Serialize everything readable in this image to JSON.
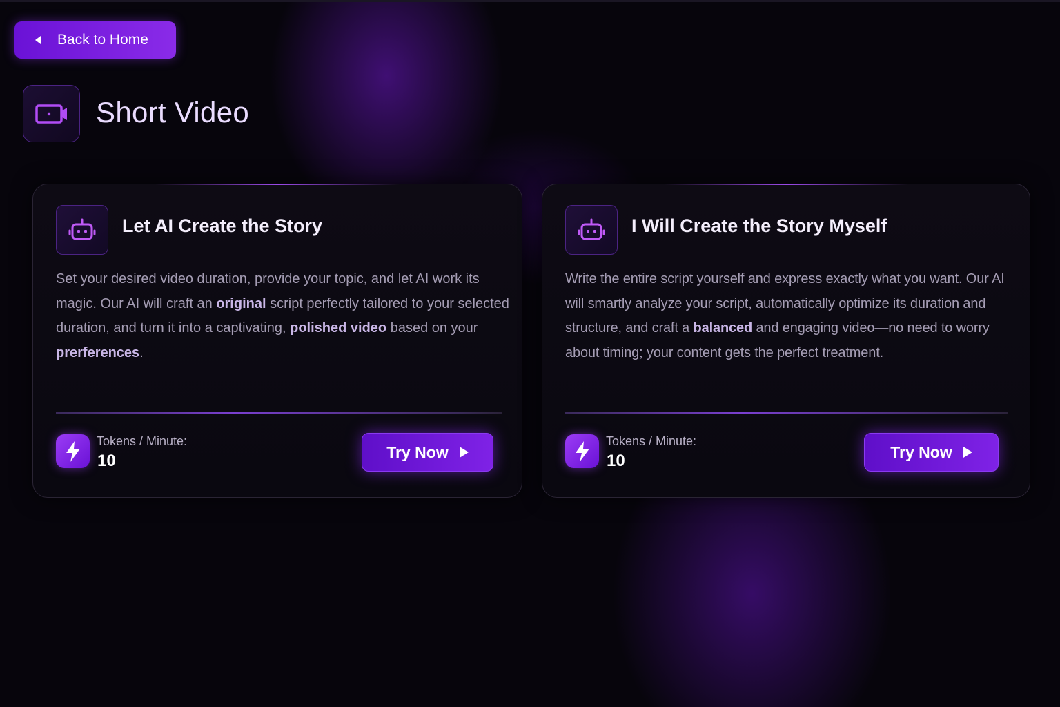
{
  "nav": {
    "back_label": "Back to Home"
  },
  "header": {
    "title": "Short Video",
    "icon": "video-camera-icon"
  },
  "cards": [
    {
      "icon": "robot-icon",
      "title": "Let AI Create the Story",
      "description": [
        {
          "text": "Set your desired video duration, provide your topic, and let AI work its magic. Our AI will craft an ",
          "highlight": false
        },
        {
          "text": "original",
          "highlight": true
        },
        {
          "text": " script perfectly tailored to your selected duration, and turn it into a captivating, ",
          "highlight": false
        },
        {
          "text": "polished video",
          "highlight": true
        },
        {
          "text": " based on your ",
          "highlight": false
        },
        {
          "text": "prerferences",
          "highlight": true
        },
        {
          "text": ".",
          "highlight": false
        }
      ],
      "tokens_label": "Tokens / Minute:",
      "tokens_value": "10",
      "cta_label": "Try Now"
    },
    {
      "icon": "robot-icon",
      "title": "I Will Create the Story Myself",
      "description": [
        {
          "text": "Write the entire script yourself and express exactly what you want. Our AI will smartly analyze your script, automatically optimize its duration and structure, and craft a ",
          "highlight": false
        },
        {
          "text": "balanced",
          "highlight": true
        },
        {
          "text": " and engaging video—no need to worry about timing; your content gets the perfect treatment.",
          "highlight": false
        }
      ],
      "tokens_label": "Tokens / Minute:",
      "tokens_value": "10",
      "cta_label": "Try Now"
    }
  ],
  "colors": {
    "accent": "#7f22e6",
    "background": "#07050c",
    "card_border": "#2a2434"
  }
}
